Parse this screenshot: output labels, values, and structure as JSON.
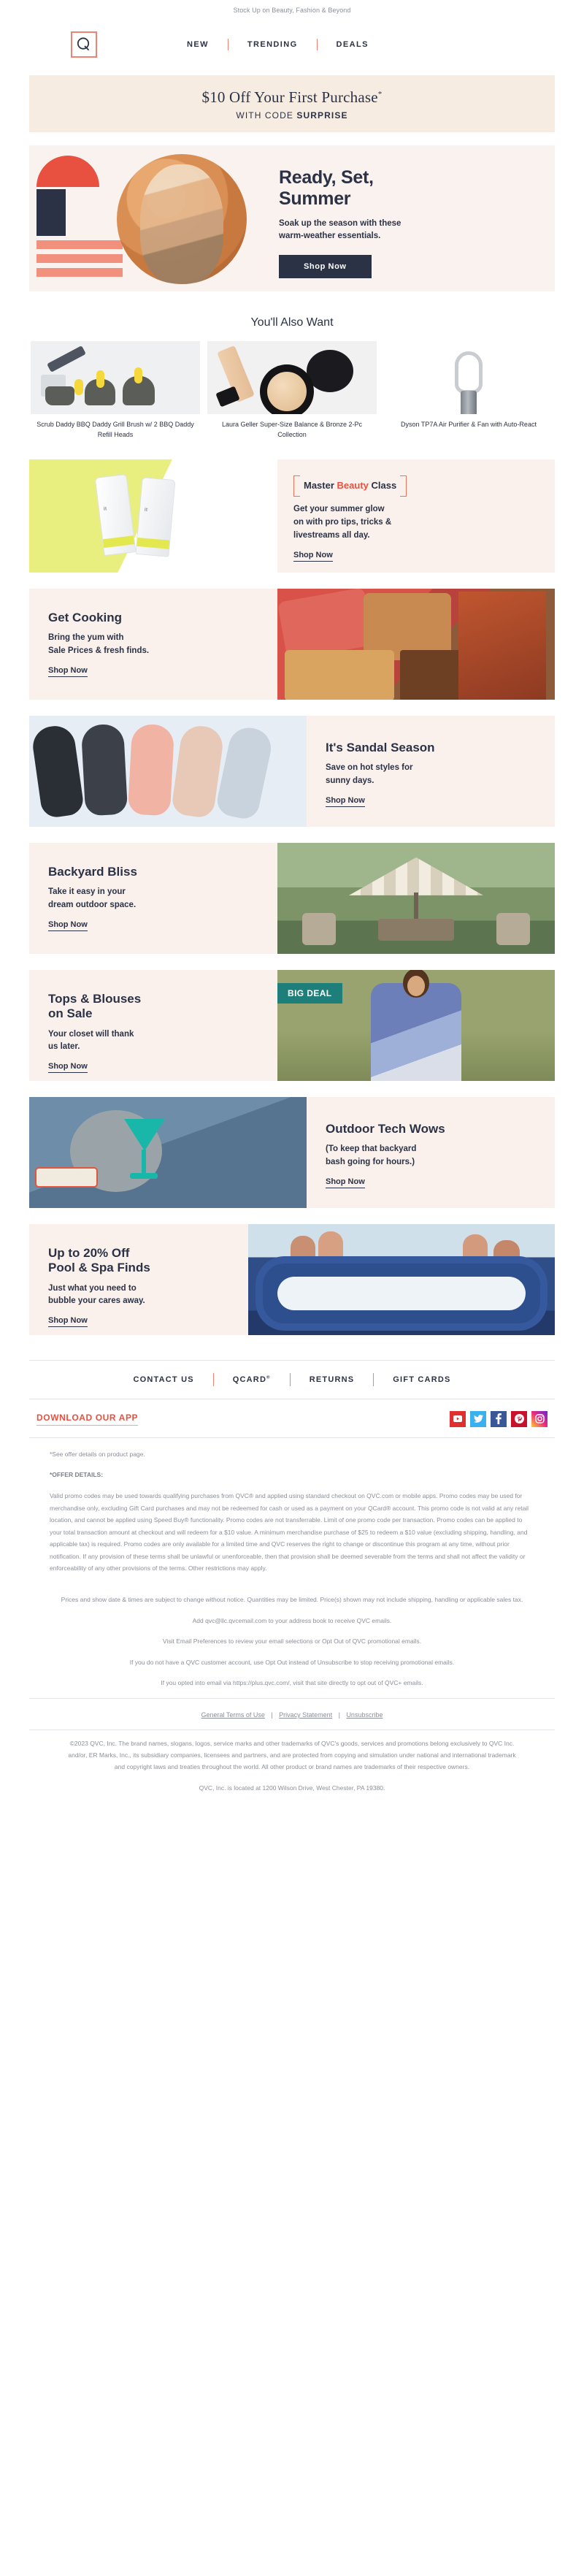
{
  "preheader": "Stock Up on Beauty, Fashion & Beyond",
  "nav": {
    "logo_letter": "Q",
    "items": [
      {
        "label": "NEW"
      },
      {
        "label": "TRENDING"
      },
      {
        "label": "DEALS"
      }
    ]
  },
  "promo": {
    "headline": "$10 Off Your First Purchase",
    "asterisk": "*",
    "sub_prefix": "WITH CODE ",
    "sub_code": "SURPRISE"
  },
  "hero": {
    "title_line1": "Ready, Set,",
    "title_line2": "Summer",
    "body_line1": "Soak up the season with these",
    "body_line2": "warm-weather essentials.",
    "cta": "Shop Now"
  },
  "products_section": {
    "title": "You'll Also Want",
    "items": [
      {
        "name": "Scrub Daddy BBQ Daddy Grill Brush w/ 2 BBQ Daddy Refill Heads",
        "art": "scrub"
      },
      {
        "name": "Laura Geller Super-Size Balance & Bronze 2-Pc Collection",
        "art": "laura"
      },
      {
        "name": "Dyson TP7A Air Purifier & Fan with Auto-React",
        "art": "dyson"
      }
    ]
  },
  "beauty": {
    "badge_pre": "Master ",
    "badge_accent": "Beauty",
    "badge_post": " Class",
    "body_line1": "Get your summer glow",
    "body_line2": "on with pro tips, tricks &",
    "body_line3": "livestreams all day.",
    "cta": "Shop Now"
  },
  "rows": [
    {
      "id": "get-cooking",
      "headline": "Get Cooking",
      "body_line1": "Bring the yum with",
      "body_line2": "Sale Prices & fresh finds.",
      "cta": "Shop Now"
    },
    {
      "id": "sandal-season",
      "headline": "It's Sandal Season",
      "body_line1": "Save on hot styles for",
      "body_line2": "sunny days.",
      "cta": "Shop Now"
    },
    {
      "id": "backyard-bliss",
      "headline": "Backyard Bliss",
      "body_line1": "Take it easy in your",
      "body_line2": "dream outdoor space.",
      "cta": "Shop Now"
    },
    {
      "id": "tops-blouses",
      "headline_line1": "Tops & Blouses",
      "headline_line2": "on Sale",
      "body_line1": "Your closet will thank",
      "body_line2": "us later.",
      "cta": "Shop Now",
      "badge": "BIG DEAL"
    },
    {
      "id": "outdoor-tech",
      "headline": "Outdoor Tech Wows",
      "body_line1": "(To keep that backyard",
      "body_line2": "bash going for hours.)",
      "cta": "Shop Now"
    },
    {
      "id": "pool-spa",
      "headline_line1": "Up to 20% Off",
      "headline_line2": "Pool & Spa Finds",
      "body_line1": "Just what you need to",
      "body_line2": "bubble your cares away.",
      "cta": "Shop Now"
    }
  ],
  "footer": {
    "links": [
      {
        "label": "CONTACT US"
      },
      {
        "label": "QCARD",
        "sup": "®"
      },
      {
        "label": "RETURNS"
      },
      {
        "label": "GIFT CARDS"
      }
    ],
    "download_app": "DOWNLOAD OUR APP",
    "socials": [
      {
        "name": "youtube-icon",
        "glyph": "▶"
      },
      {
        "name": "twitter-icon",
        "glyph": "🐦"
      },
      {
        "name": "facebook-icon",
        "glyph": "f"
      },
      {
        "name": "pinterest-icon",
        "glyph": "𝐏"
      },
      {
        "name": "instagram-icon",
        "glyph": "◎"
      }
    ],
    "see_offer": "*See offer details on product page.",
    "offer_details_heading": "*OFFER DETAILS:",
    "offer_details_body": "Valid promo codes may be used towards qualifying purchases from QVC® and applied using standard checkout on QVC.com or mobile apps. Promo codes may be used for merchandise only, excluding Gift Card purchases and may not be redeemed for cash or used as a payment on your QCard® account. This promo code is not valid at any retail location, and cannot be applied using Speed Buy® functionality. Promo codes are not transferrable. Limit of one promo code per transaction. Promo codes can be applied to your total transaction amount at checkout and will redeem for a $10 value. A minimum merchandise purchase of $25 to redeem a $10 value (excluding shipping, handling, and applicable tax) is required. Promo codes are only available for a limited time and QVC reserves the right to change or discontinue this program at any time, without prior notification. If any provision of these terms shall be unlawful or unenforceable, then that provision shall be deemed severable from the terms and shall not affect the validity or enforceability of any other provisions of the terms. Other restrictions may apply.",
    "prices_note": "Prices and show date & times are subject to change without notice. Quantities may be limited. Price(s) shown may not include shipping, handling or applicable sales tax.",
    "email_line1": "Add qvc@llc.qvcemail.com to your address book to receive QVC emails.",
    "email_line2": "Visit Email Preferences to review your email selections or Opt Out of QVC promotional emails.",
    "email_line3": "If you do not have a QVC customer account, use Opt Out instead of Unsubscribe to stop receiving promotional emails.",
    "email_line4": "If you opted into email via https://plus.qvc.com/, visit that site directly to opt out of QVC+ emails.",
    "terms_links": [
      {
        "label": "General Terms of Use"
      },
      {
        "label": "Privacy Statement"
      },
      {
        "label": "Unsubscribe"
      }
    ],
    "terms_sep": "|",
    "copyright": "©2023 QVC, Inc. The brand names, slogans, logos, service marks and other trademarks of QVC's goods, services and promotions belong exclusively to QVC Inc. and/or, ER Marks, Inc., its subsidiary companies, licensees and partners, and are protected from copying and simulation under national and international trademark and copyright laws and treaties throughout the world. All other product or brand names are trademarks of their respective owners.",
    "address": "QVC, Inc. is located at 1200 Wilson Drive, West Chester, PA 19380."
  },
  "colors": {
    "accent": "#e8503f",
    "navy": "#2b3245",
    "cream": "#faf0ec",
    "promo_bg": "#f7ece2",
    "teal_badge": "#1e7f7a"
  }
}
